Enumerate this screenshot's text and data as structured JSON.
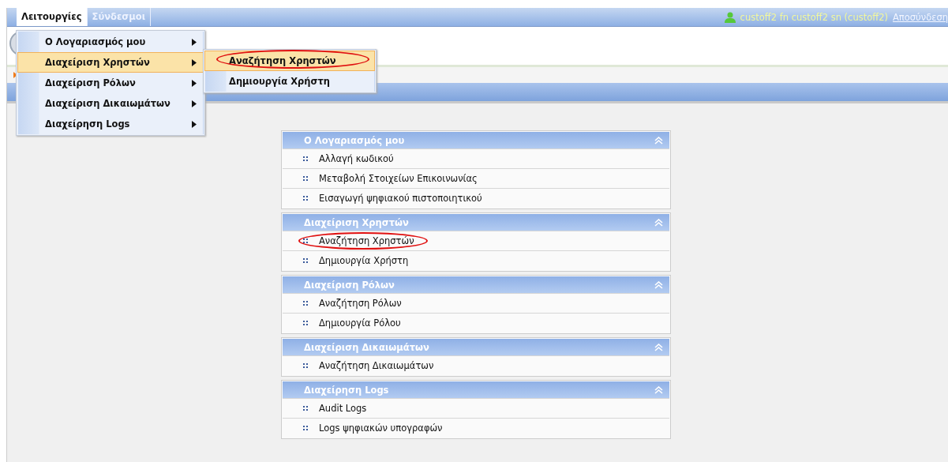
{
  "menubar": {
    "items": [
      {
        "label": "Λειτουργίες",
        "selected": true
      },
      {
        "label": "Σύνδεσμοι",
        "selected": false
      }
    ]
  },
  "user": {
    "name": "custoff2 fn custoff2 sn (custoff2)",
    "logout": "Αποσύνδεση"
  },
  "dropdown": {
    "items": [
      {
        "label": "Ο Λογαριασμός μου",
        "selected": false
      },
      {
        "label": "Διαχείριση Χρηστών",
        "selected": true
      },
      {
        "label": "Διαχείριση Ρόλων",
        "selected": false
      },
      {
        "label": "Διαχείριση Δικαιωμάτων",
        "selected": false
      },
      {
        "label": "Διαχείρηση Logs",
        "selected": false
      }
    ]
  },
  "submenu": {
    "items": [
      {
        "label": "Αναζήτηση Χρηστών",
        "selected": true,
        "circled": true
      },
      {
        "label": "Δημιουργία Χρήστη",
        "selected": false,
        "circled": false
      }
    ]
  },
  "panels": [
    {
      "title": "Ο Λογαριασμός μου",
      "expanded": true,
      "items": [
        {
          "label": "Αλλαγή κωδικού",
          "circled": false
        },
        {
          "label": "Μεταβολή Στοιχείων Επικοινωνίας",
          "circled": false
        },
        {
          "label": "Εισαγωγή ψηφιακού πιστοποιητικού",
          "circled": false
        }
      ]
    },
    {
      "title": "Διαχείριση Χρηστών",
      "expanded": true,
      "items": [
        {
          "label": "Αναζήτηση Χρηστών",
          "circled": true
        },
        {
          "label": "Δημιουργία Χρήστη",
          "circled": false
        }
      ]
    },
    {
      "title": "Διαχείριση Ρόλων",
      "expanded": true,
      "items": [
        {
          "label": "Αναζήτηση Ρόλων",
          "circled": false
        },
        {
          "label": "Δημιουργία Ρόλου",
          "circled": false
        }
      ]
    },
    {
      "title": "Διαχείριση Δικαιωμάτων",
      "expanded": true,
      "items": [
        {
          "label": "Αναζήτηση Δικαιωμάτων",
          "circled": false
        }
      ]
    },
    {
      "title": "Διαχείρηση Logs",
      "expanded": true,
      "items": [
        {
          "label": "Audit Logs",
          "circled": false
        },
        {
          "label": "Logs ψηφιακών υπογραφών",
          "circled": false
        }
      ]
    }
  ]
}
